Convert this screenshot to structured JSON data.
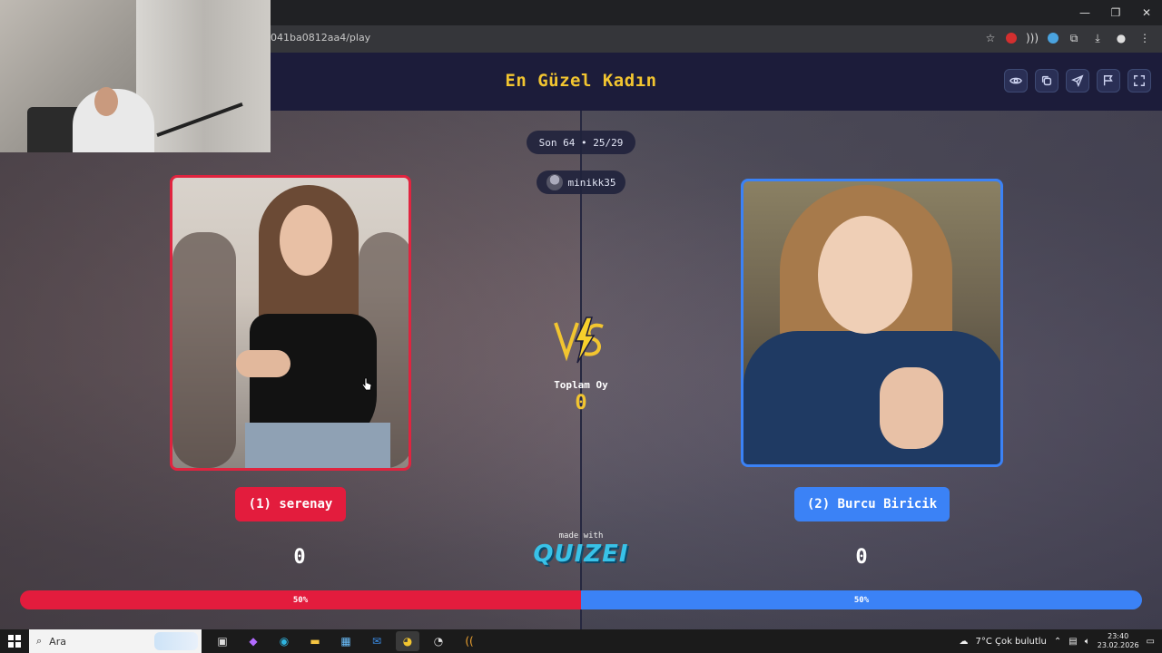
{
  "browser": {
    "url": "041ba0812aa4/play",
    "controls": {
      "minimize": "—",
      "restore": "❐",
      "close": "✕"
    }
  },
  "app": {
    "title": "En Güzel Kadın",
    "header_buttons": [
      "eye-icon",
      "copy-icon",
      "send-icon",
      "flag-icon",
      "fullscreen-icon"
    ]
  },
  "round": {
    "label": "Son 64 • 25/29"
  },
  "user": {
    "name": "minikk35"
  },
  "total": {
    "label": "Toplam Oy",
    "value": "0"
  },
  "left": {
    "name": "(1) serenay",
    "score": "0",
    "percent_label": "50%",
    "percent": 50,
    "color": "#e31c3d"
  },
  "right": {
    "name": "(2) Burcu Biricik",
    "score": "0",
    "percent_label": "50%",
    "percent": 50,
    "color": "#3b82f6"
  },
  "branding": {
    "made_with": "made with",
    "logo": "QUIZEI"
  },
  "taskbar": {
    "search_placeholder": "Ara",
    "weather": "7°C  Çok bulutlu",
    "time": "23:40",
    "date": "23.02.2026"
  }
}
